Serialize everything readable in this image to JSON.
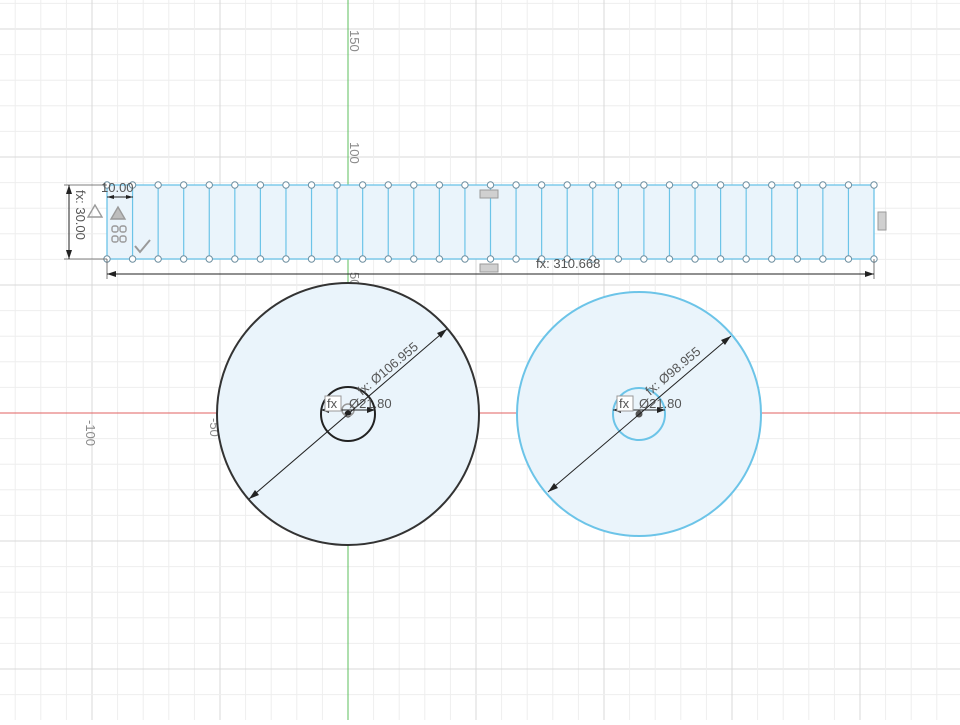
{
  "axis_labels": {
    "v150": "150",
    "v100": "100",
    "v50": "50",
    "h_neg100": "-100",
    "h_neg50": "-50"
  },
  "dimensions": {
    "strip_width": "fx: 310.668",
    "strip_height": "fx: 30.00",
    "segment_width": "10.00",
    "circle1_outer": "fx: Ø106.955",
    "circle1_inner": "Ø21.80",
    "circle2_outer": "fx: Ø98.955",
    "circle2_inner": "Ø21.80",
    "fx_badge": "fx"
  },
  "constraint_icons": [
    "triangle-constraint-icon",
    "hatch-constraint-icon",
    "chain-constraint-icon",
    "check-constraint-icon",
    "equal-constraint-icon"
  ],
  "colors": {
    "background": "#ffffff",
    "grid_minor": "#eeeeee",
    "grid_major": "#d8d8d8",
    "x_axis": "#e06060",
    "y_axis": "#5cbf5c",
    "sketch_line": "#6cc4e8",
    "sketch_fill": "#eaf4fb",
    "dim_black": "#222222"
  }
}
